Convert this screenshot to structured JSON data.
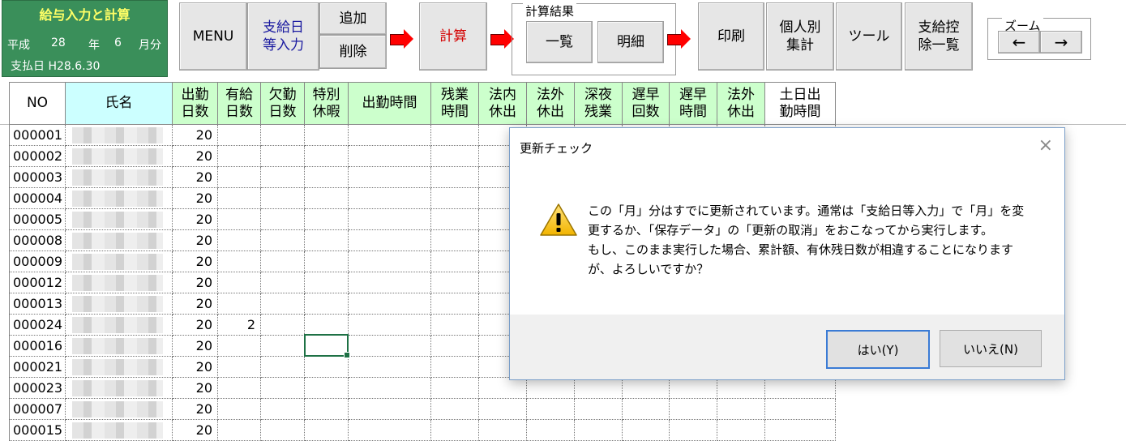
{
  "header": {
    "title": "給与入力と計算",
    "era": "平成",
    "year": "28",
    "year_unit": "年",
    "month": "6",
    "month_unit": "月分",
    "payday_label": "支払日",
    "payday": "H28.6.30"
  },
  "toolbar": {
    "menu": "MENU",
    "payday_input": "支給日\n等入力",
    "add": "追加",
    "delete": "削除",
    "calc": "計算",
    "result_group": "計算結果",
    "list": "一覧",
    "detail": "明細",
    "print": "印刷",
    "individual": "個人別\n集計",
    "tools": "ツール",
    "deduction_list": "支給控\n除一覧",
    "zoom_group": "ズーム",
    "zoom_out": "←",
    "zoom_in": "→"
  },
  "table": {
    "headers": [
      "NO",
      "氏名",
      "出勤\n日数",
      "有給\n日数",
      "欠勤\n日数",
      "特別\n休暇",
      "出勤時間",
      "残業\n時間",
      "法内\n休出",
      "法外\n休出",
      "深夜\n残業",
      "遅早\n回数",
      "遅早\n時間",
      "法外\n休出",
      "土日出\n勤時間"
    ],
    "rows": [
      {
        "no": "000001",
        "days": "20",
        "paid": ""
      },
      {
        "no": "000002",
        "days": "20",
        "paid": ""
      },
      {
        "no": "000003",
        "days": "20",
        "paid": ""
      },
      {
        "no": "000004",
        "days": "20",
        "paid": ""
      },
      {
        "no": "000005",
        "days": "20",
        "paid": ""
      },
      {
        "no": "000008",
        "days": "20",
        "paid": ""
      },
      {
        "no": "000009",
        "days": "20",
        "paid": ""
      },
      {
        "no": "000012",
        "days": "20",
        "paid": ""
      },
      {
        "no": "000013",
        "days": "20",
        "paid": ""
      },
      {
        "no": "000024",
        "days": "20",
        "paid": "2"
      },
      {
        "no": "000016",
        "days": "20",
        "paid": ""
      },
      {
        "no": "000021",
        "days": "20",
        "paid": ""
      },
      {
        "no": "000023",
        "days": "20",
        "paid": ""
      },
      {
        "no": "000007",
        "days": "20",
        "paid": ""
      },
      {
        "no": "000015",
        "days": "20",
        "paid": ""
      }
    ]
  },
  "dialog": {
    "title": "更新チェック",
    "close": "×",
    "message_line1": "この「月」分はすでに更新されています。通常は「支給日等入力」で「月」を変",
    "message_line2": "更するか、「保存データ」の「更新の取消」をおこなってから実行します。",
    "message_line3": "もし、このまま実行した場合、累計額、有休残日数が相違することになります",
    "message_line4": "が、よろしいですか？",
    "yes": "はい(Y)",
    "no": "いいえ(N)"
  },
  "colors": {
    "title_bg": "#3a8f5a",
    "title_text": "#ffff66",
    "header_green": "#ccffcc",
    "header_cyan": "#ccffff",
    "calc_text": "#d40000",
    "payday_text": "#1a1aa0"
  }
}
